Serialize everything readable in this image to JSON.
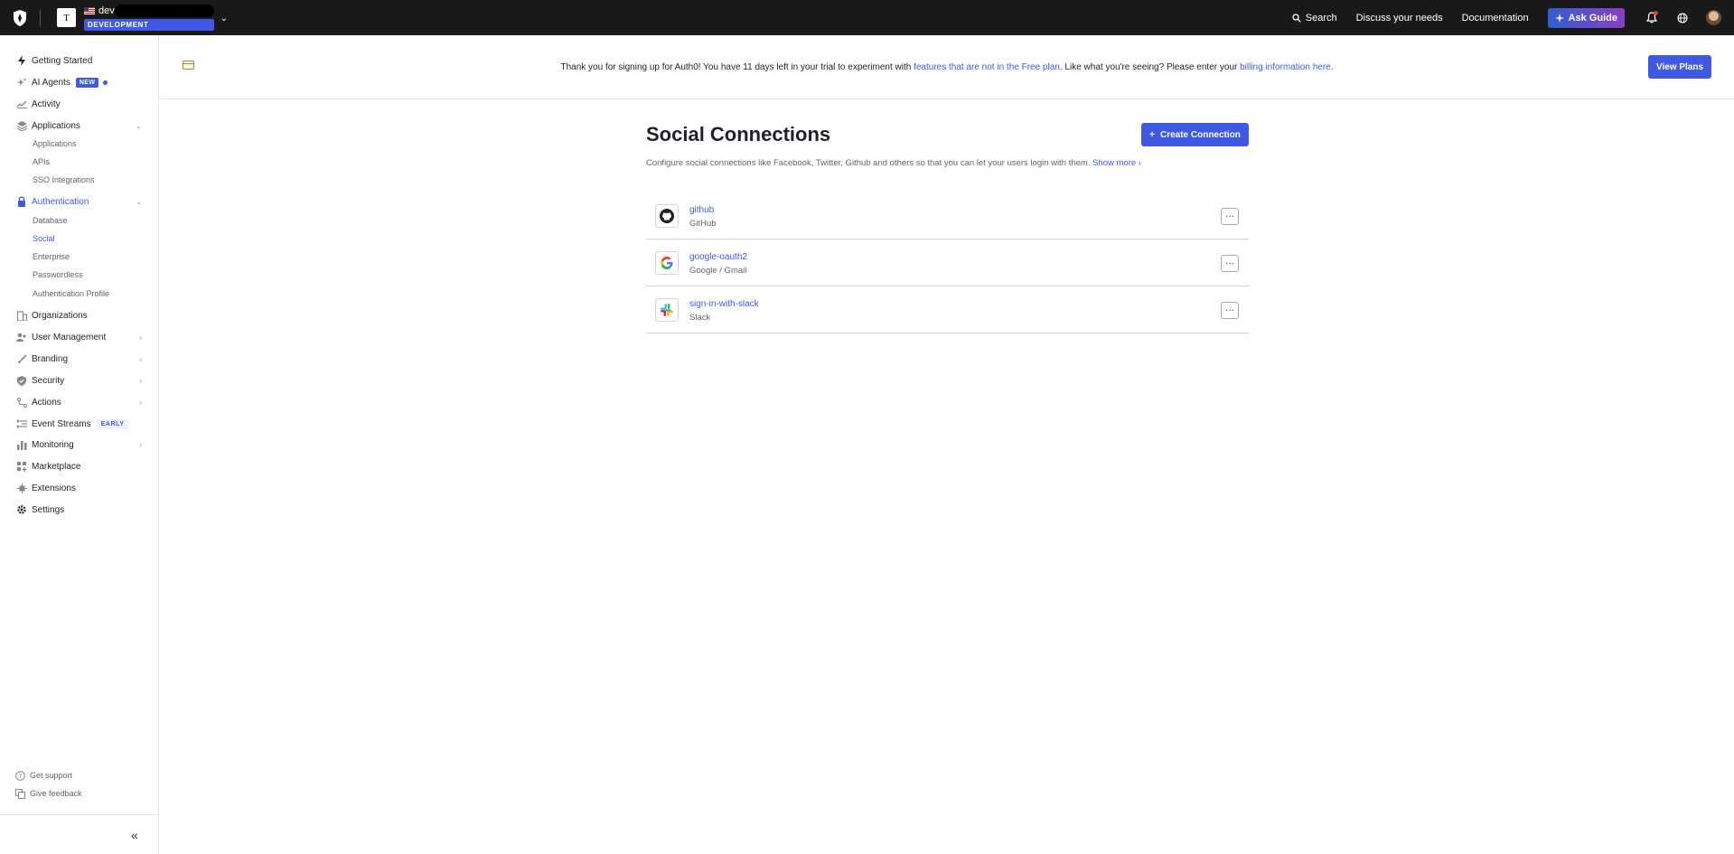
{
  "topbar": {
    "tenant_initial": "T",
    "tenant_name": "dev",
    "tenant_badge": "DEVELOPMENT",
    "search_label": "Search",
    "discuss_label": "Discuss your needs",
    "docs_label": "Documentation",
    "ask_guide_label": "Ask Guide"
  },
  "sidebar": {
    "getting_started": "Getting Started",
    "ai_agents": "AI Agents",
    "ai_agents_badge": "NEW",
    "activity": "Activity",
    "applications": "Applications",
    "applications_sub": [
      "Applications",
      "APIs",
      "SSO Integrations"
    ],
    "authentication": "Authentication",
    "authentication_sub": [
      "Database",
      "Social",
      "Enterprise",
      "Passwordless",
      "Authentication Profile"
    ],
    "organizations": "Organizations",
    "user_management": "User Management",
    "branding": "Branding",
    "security": "Security",
    "actions": "Actions",
    "event_streams": "Event Streams",
    "event_streams_badge": "EARLY",
    "monitoring": "Monitoring",
    "marketplace": "Marketplace",
    "extensions": "Extensions",
    "settings": "Settings",
    "get_support": "Get support",
    "give_feedback": "Give feedback",
    "collapse_glyph": "«"
  },
  "banner": {
    "text_1": "Thank you for signing up for Auth0! You have 11 days left in your trial to experiment with ",
    "link_1": "features that are not in the Free plan",
    "text_2": ". Like what you're seeing? Please enter your ",
    "link_2": "billing information here",
    "text_3": ".",
    "button": "View Plans"
  },
  "main": {
    "title": "Social Connections",
    "create_button": "Create Connection",
    "description": "Configure social connections like Facebook, Twitter, Github and others so that you can let your users login with them. ",
    "show_more": "Show more",
    "connections": [
      {
        "name": "github",
        "strategy": "GitHub",
        "icon": "github-icon"
      },
      {
        "name": "google-oauth2",
        "strategy": "Google / Gmail",
        "icon": "google-icon"
      },
      {
        "name": "sign-in-with-slack",
        "strategy": "Slack",
        "icon": "slack-icon"
      }
    ],
    "menu_glyph": "···"
  },
  "colors": {
    "accent": "#3f59e4",
    "topbar": "#191919",
    "notification": "#e53b2f"
  }
}
